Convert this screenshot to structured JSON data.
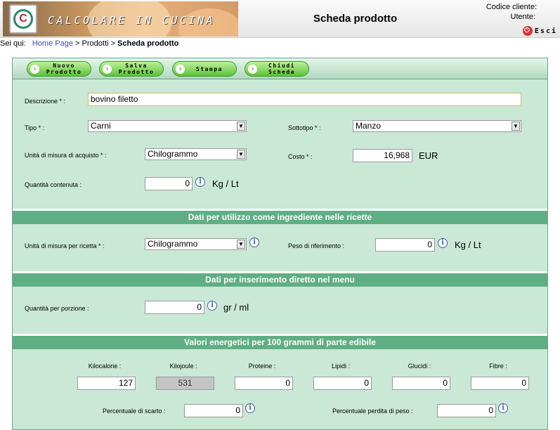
{
  "header": {
    "brand": "CALCOLARE IN CUCINA",
    "logo_letter": "C",
    "page_title": "Scheda prodotto",
    "codice_cliente_label": "Codice cliente:",
    "utente_label": "Utente:",
    "esci_label": "Esci"
  },
  "breadcrumb": {
    "prefix": "Sei qui:",
    "home": "Home Page",
    "sep1": ">",
    "prodotti": "Prodotti",
    "sep2": ">",
    "current": "Scheda prodotto"
  },
  "toolbar": {
    "nuovo": [
      "Nuovo",
      "Prodotto"
    ],
    "salva": [
      "Salva",
      "Prodotto"
    ],
    "stampa": "Stampa",
    "chiudi": [
      "Chiudi",
      "Scheda"
    ]
  },
  "form": {
    "descrizione_label": "Descrizione * :",
    "descrizione_value": "bovino filetto",
    "tipo_label": "Tipo * :",
    "tipo_value": "Carni",
    "sottotipo_label": "Sottotipo * :",
    "sottotipo_value": "Manzo",
    "unita_acquisto_label": "Unità di misura di acquisto * :",
    "unita_acquisto_value": "Chilogrammo",
    "costo_label": "Costo * :",
    "costo_value": "16,968",
    "costo_unit": "EUR",
    "quantita_contenuta_label": "Quantità contenuta :",
    "quantita_contenuta_value": "0",
    "quantita_contenuta_unit": "Kg / Lt"
  },
  "ricette": {
    "title": "Dati per utilizzo come ingrediente nelle ricette",
    "unita_label": "Unità di misura per ricetta * :",
    "unita_value": "Chilogrammo",
    "peso_label": "Peso di riferimento :",
    "peso_value": "0",
    "peso_unit": "Kg / Lt"
  },
  "menu": {
    "title": "Dati per inserimento diretto nel menu",
    "porzione_label": "Quantità per porzione :",
    "porzione_value": "0",
    "porzione_unit": "gr / ml"
  },
  "nutrition": {
    "title": "Valori energetici per 100 grammi di parte edibile",
    "fields": [
      {
        "label": "Kilocalorie :",
        "value": "127"
      },
      {
        "label": "Kilojoule :",
        "value": "531"
      },
      {
        "label": "Proteine :",
        "value": "0"
      },
      {
        "label": "Lipidi :",
        "value": "0"
      },
      {
        "label": "Glucidi :",
        "value": "0"
      },
      {
        "label": "Fibre :",
        "value": "0"
      }
    ],
    "scarto_label": "Percentuale di scarto :",
    "scarto_value": "0",
    "perdita_label": "Percentuale perdita di peso :",
    "perdita_value": "0"
  },
  "colors": {
    "panel_bg": "#c9e8d5",
    "section_header": "#5fae84",
    "button_green": "#5cc23a",
    "info_blue": "#3a64b4",
    "esci_red": "#d63030"
  }
}
